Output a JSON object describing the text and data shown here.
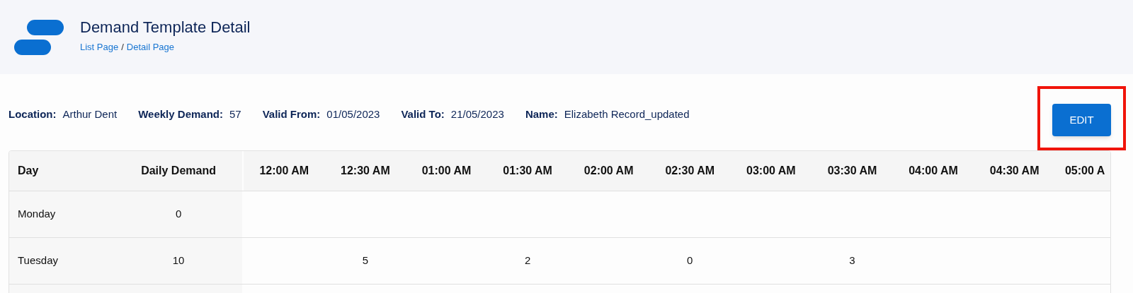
{
  "header": {
    "title": "Demand Template Detail",
    "breadcrumb": [
      {
        "label": "List Page"
      },
      {
        "label": "Detail Page"
      }
    ],
    "separator": "/"
  },
  "info": [
    {
      "label": "Location:",
      "value": "Arthur Dent"
    },
    {
      "label": "Weekly Demand:",
      "value": "57"
    },
    {
      "label": "Valid From:",
      "value": "01/05/2023"
    },
    {
      "label": "Valid To:",
      "value": "21/05/2023"
    },
    {
      "label": "Name:",
      "value": "Elizabeth Record_updated"
    }
  ],
  "edit_button": {
    "label": "EDIT",
    "highlighted": true
  },
  "table": {
    "columns": [
      "Day",
      "Daily Demand"
    ],
    "time_columns": [
      "12:00 AM",
      "12:30 AM",
      "01:00 AM",
      "01:30 AM",
      "02:00 AM",
      "02:30 AM",
      "03:00 AM",
      "03:30 AM",
      "04:00 AM",
      "04:30 AM",
      "05:00 A"
    ],
    "rows": [
      {
        "day": "Monday",
        "daily_demand": "0",
        "cells": [
          {},
          {},
          {},
          {},
          {},
          {},
          {},
          {},
          {},
          {},
          {}
        ]
      },
      {
        "day": "Tuesday",
        "daily_demand": "10",
        "cells": [
          {},
          {
            "value": "5"
          },
          {},
          {
            "value": "2"
          },
          {},
          {
            "value": "0"
          },
          {},
          {
            "value": "3"
          },
          {},
          {},
          {}
        ]
      }
    ]
  }
}
